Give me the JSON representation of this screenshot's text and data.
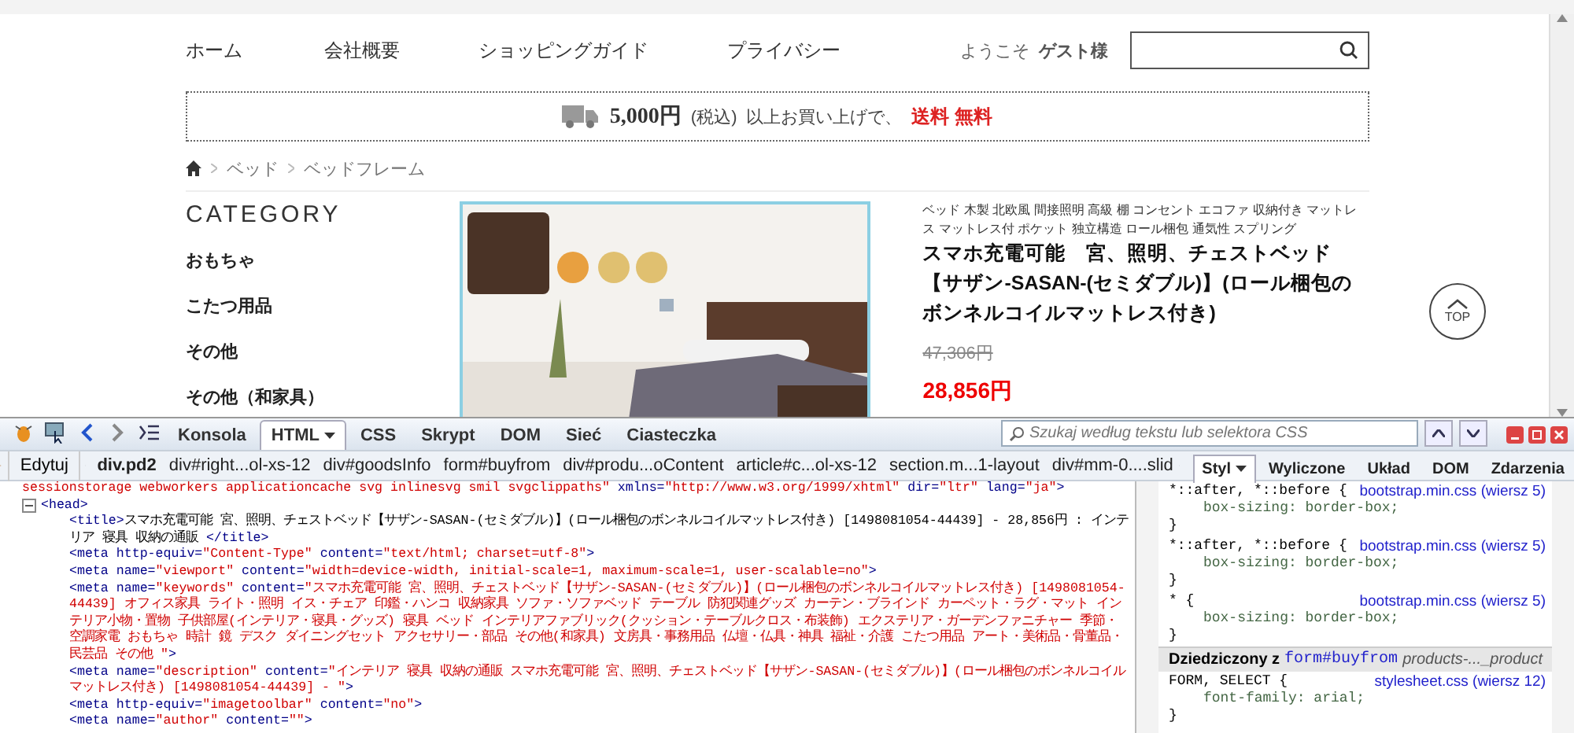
{
  "site": {
    "nav": [
      "ホーム",
      "会社概要",
      "ショッピングガイド",
      "プライバシー"
    ],
    "welcome": "ようこそ",
    "user": "ゲスト様",
    "shipping": {
      "amount": "5,000円",
      "tax": "(税込)",
      "text": "以上お買い上げで、",
      "free": "送料 無料"
    },
    "breadcrumb": [
      "ベッド",
      "ベッドフレーム"
    ],
    "category": {
      "title": "CATEGORY",
      "items": [
        "おもちゃ",
        "こたつ用品",
        "その他",
        "その他（和家具）"
      ]
    },
    "product": {
      "keywords": "ベッド 木製 北欧風 間接照明 高級 棚 コンセント エコファ 収納付き マットレス マットレス付 ポケット 独立構造 ロール梱包 通気性 スプリング",
      "title": "スマホ充電可能　宮、照明、チェストベッド【サザン-SASAN-(セミダブル)】(ロール梱包のボンネルコイルマットレス付き)",
      "old_price": "47,306円",
      "price": "28,856円"
    },
    "top_button": "TOP"
  },
  "devtools": {
    "tabs": [
      {
        "label": "Konsola",
        "selected": false
      },
      {
        "label": "HTML",
        "selected": true
      },
      {
        "label": "CSS",
        "selected": false
      },
      {
        "label": "Skrypt",
        "selected": false
      },
      {
        "label": "DOM",
        "selected": false
      },
      {
        "label": "Sieć",
        "selected": false
      },
      {
        "label": "Ciasteczka",
        "selected": false
      }
    ],
    "search": {
      "placeholder": "Szukaj według tekstu lub selektora CSS"
    },
    "edit_button": "Edytuj",
    "crumbs": [
      {
        "label": "div.pd2",
        "selected": true
      },
      {
        "label": "div#right...ol-xs-12",
        "selected": false
      },
      {
        "label": "div#goodsInfo",
        "selected": false
      },
      {
        "label": "form#buyfrom",
        "selected": false
      },
      {
        "label": "div#produ...oContent",
        "selected": false
      },
      {
        "label": "article#c...ol-xs-12",
        "selected": false
      },
      {
        "label": "section.m...1-layout",
        "selected": false
      },
      {
        "label": "div#mm-0....slid",
        "selected": false
      }
    ],
    "side_tabs": [
      {
        "label": "Styl",
        "selected": true
      },
      {
        "label": "Wyliczone",
        "selected": false
      },
      {
        "label": "Układ",
        "selected": false
      },
      {
        "label": "DOM",
        "selected": false
      },
      {
        "label": "Zdarzenia",
        "selected": false
      }
    ],
    "html": {
      "first_line": [
        {
          "kind": "value",
          "text": "sessionstorage webworkers applicationcache svg inlinesvg smil svgclippaths\""
        },
        {
          "kind": "attr",
          "text": " xmlns="
        },
        {
          "kind": "value",
          "text": "\"http://www.w3.org/1999/xhtml\""
        },
        {
          "kind": "attr",
          "text": " dir="
        },
        {
          "kind": "value",
          "text": "\"ltr\""
        },
        {
          "kind": "attr",
          "text": " lang="
        },
        {
          "kind": "value",
          "text": "\"ja\""
        },
        {
          "kind": "tag",
          "text": ">"
        }
      ],
      "node": {
        "tag": "<head>",
        "expanded": true,
        "children": [
          [
            {
              "kind": "tag",
              "text": "<title>"
            },
            {
              "kind": "text",
              "text": "スマホ充電可能 宮、照明、チェストベッド【サザン-SASAN-(セミダブル)】(ロール梱包のボンネルコイルマットレス付き) [1498081054-44439] - 28,856円 : インテリア 寝具 収納の通販 "
            },
            {
              "kind": "tag",
              "text": "</title>"
            }
          ],
          [
            {
              "kind": "tag",
              "text": "<meta"
            },
            {
              "kind": "attr",
              "text": " http-equiv="
            },
            {
              "kind": "value",
              "text": "\"Content-Type\""
            },
            {
              "kind": "attr",
              "text": " content="
            },
            {
              "kind": "value",
              "text": "\"text/html; charset=utf-8\""
            },
            {
              "kind": "tag",
              "text": ">"
            }
          ],
          [
            {
              "kind": "tag",
              "text": "<meta"
            },
            {
              "kind": "attr",
              "text": " name="
            },
            {
              "kind": "value",
              "text": "\"viewport\""
            },
            {
              "kind": "attr",
              "text": " content="
            },
            {
              "kind": "value",
              "text": "\"width=device-width, initial-scale=1, maximum-scale=1, user-scalable=no\""
            },
            {
              "kind": "tag",
              "text": ">"
            }
          ],
          [
            {
              "kind": "tag",
              "text": "<meta"
            },
            {
              "kind": "attr",
              "text": " name="
            },
            {
              "kind": "value",
              "text": "\"keywords\""
            },
            {
              "kind": "attr",
              "text": " content="
            },
            {
              "kind": "value",
              "text": "\"スマホ充電可能 宮、照明、チェストベッド【サザン-SASAN-(セミダブル)】(ロール梱包のボンネルコイルマットレス付き) [1498081054-44439] オフィス家具 ライト・照明 イス・チェア 印鑑・ハンコ 収納家具 ソファ・ソファベッド テーブル 防犯関連グッズ カーテン・ブラインド カーペット・ラグ・マット インテリア小物・置物 子供部屋(インテリア・寝具・グッズ) 寝具 ベッド インテリアファブリック(クッション・テーブルクロス・布装飾) エクステリア・ガーデンファニチャー 季節・空調家電 おもちゃ 時計 鏡 デスク ダイニングセット アクセサリー・部品 その他(和家具) 文房具・事務用品 仏壇・仏具・神具 福祉・介護 こたつ用品 アート・美術品・骨董品・民芸品 その他 \""
            },
            {
              "kind": "tag",
              "text": ">"
            }
          ],
          [
            {
              "kind": "tag",
              "text": "<meta"
            },
            {
              "kind": "attr",
              "text": " name="
            },
            {
              "kind": "value",
              "text": "\"description\""
            },
            {
              "kind": "attr",
              "text": " content="
            },
            {
              "kind": "value",
              "text": "\"インテリア 寝具 収納の通販 スマホ充電可能 宮、照明、チェストベッド【サザン-SASAN-(セミダブル)】(ロール梱包のボンネルコイルマットレス付き) [1498081054-44439] - \""
            },
            {
              "kind": "tag",
              "text": ">"
            }
          ],
          [
            {
              "kind": "tag",
              "text": "<meta"
            },
            {
              "kind": "attr",
              "text": " http-equiv="
            },
            {
              "kind": "value",
              "text": "\"imagetoolbar\""
            },
            {
              "kind": "attr",
              "text": " content="
            },
            {
              "kind": "value",
              "text": "\"no\""
            },
            {
              "kind": "tag",
              "text": ">"
            }
          ],
          [
            {
              "kind": "tag",
              "text": "<meta"
            },
            {
              "kind": "attr",
              "text": " name="
            },
            {
              "kind": "value",
              "text": "\"author\""
            },
            {
              "kind": "attr",
              "text": " content="
            },
            {
              "kind": "value",
              "text": "\"\""
            },
            {
              "kind": "tag",
              "text": ">"
            }
          ]
        ]
      }
    },
    "styles": {
      "rules": [
        {
          "selector": "*::after, *::before {",
          "source": "bootstrap.min.css (wiersz 5)",
          "declarations": [
            "box-sizing: border-box;"
          ],
          "close": "}"
        },
        {
          "selector": "*::after, *::before {",
          "source": "bootstrap.min.css (wiersz 5)",
          "declarations": [
            "box-sizing: border-box;"
          ],
          "close": "}"
        },
        {
          "selector": "* {",
          "source": "bootstrap.min.css (wiersz 5)",
          "declarations": [
            "box-sizing: border-box;"
          ],
          "close": "}"
        }
      ],
      "inherited": {
        "label": "Dziedziczony z",
        "element": "form#buyfrom",
        "classes": "products-..._product"
      },
      "inherited_rules": [
        {
          "selector": "FORM, SELECT {",
          "source": "stylesheet.css (wiersz 12)",
          "declarations": [
            "font-family: arial;"
          ],
          "close": "}"
        }
      ]
    }
  }
}
